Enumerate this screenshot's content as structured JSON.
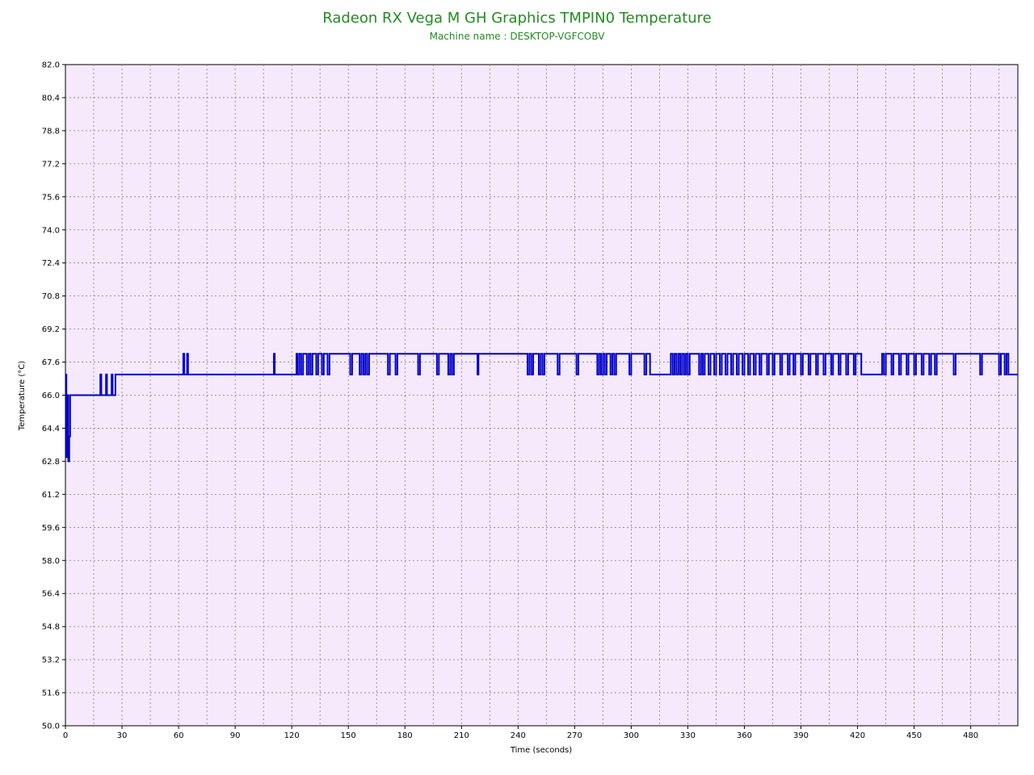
{
  "chart_data": {
    "type": "line",
    "title": "Radeon RX Vega M GH Graphics TMPIN0 Temperature",
    "subtitle": "Machine name : DESKTOP-VGFCOBV",
    "xlabel": "Time (seconds)",
    "ylabel": "Temperature (°C)",
    "xlim": [
      0,
      505
    ],
    "ylim": [
      50.0,
      82.0
    ],
    "x_ticks": [
      "0",
      "30",
      "60",
      "90",
      "120",
      "150",
      "180",
      "210",
      "240",
      "270",
      "300",
      "330",
      "360",
      "390",
      "420",
      "450",
      "480"
    ],
    "y_ticks": [
      "50.0",
      "51.6",
      "53.2",
      "54.8",
      "56.4",
      "58.0",
      "59.6",
      "61.2",
      "62.8",
      "64.4",
      "66.0",
      "67.6",
      "69.2",
      "70.8",
      "72.4",
      "74.0",
      "75.6",
      "77.2",
      "78.8",
      "80.4",
      "82.0"
    ],
    "grid": true,
    "colors": {
      "line": "#0000cc",
      "plot_bg": "#f5e9fb",
      "grid": "#808080",
      "title": "#228b22"
    },
    "series": [
      {
        "values": [
          [
            0,
            67
          ],
          [
            0.5,
            63
          ],
          [
            1,
            66
          ],
          [
            1.5,
            62.8
          ],
          [
            2,
            64
          ],
          [
            2.5,
            66
          ],
          [
            18,
            66
          ],
          [
            18.5,
            67
          ],
          [
            19,
            66
          ],
          [
            21,
            66
          ],
          [
            21.5,
            67
          ],
          [
            22,
            66
          ],
          [
            24,
            66
          ],
          [
            24.5,
            67
          ],
          [
            25,
            66
          ],
          [
            26,
            66
          ],
          [
            26.5,
            67
          ],
          [
            62,
            67
          ],
          [
            62.5,
            68
          ],
          [
            63,
            67
          ],
          [
            64,
            67
          ],
          [
            64.5,
            68
          ],
          [
            65,
            67
          ],
          [
            110,
            67
          ],
          [
            110.5,
            68
          ],
          [
            111,
            67
          ],
          [
            122,
            67
          ],
          [
            122.5,
            68
          ],
          [
            123,
            67
          ],
          [
            124,
            68
          ],
          [
            125,
            67
          ],
          [
            126,
            68
          ],
          [
            127,
            68
          ],
          [
            128,
            67
          ],
          [
            129,
            68
          ],
          [
            130,
            67
          ],
          [
            131,
            68
          ],
          [
            133,
            67
          ],
          [
            134,
            68
          ],
          [
            135,
            68
          ],
          [
            136,
            67
          ],
          [
            137,
            68
          ],
          [
            138,
            68
          ],
          [
            139,
            67
          ],
          [
            140,
            68
          ],
          [
            150,
            68
          ],
          [
            151,
            67
          ],
          [
            152,
            68
          ],
          [
            155,
            68
          ],
          [
            156,
            67
          ],
          [
            157,
            68
          ],
          [
            158,
            67
          ],
          [
            159,
            68
          ],
          [
            160,
            67
          ],
          [
            161,
            68
          ],
          [
            170,
            68
          ],
          [
            171,
            67
          ],
          [
            172,
            68
          ],
          [
            174,
            68
          ],
          [
            175,
            67
          ],
          [
            176,
            68
          ],
          [
            186,
            68
          ],
          [
            187,
            67
          ],
          [
            188,
            68
          ],
          [
            196,
            68
          ],
          [
            197,
            67
          ],
          [
            198,
            68
          ],
          [
            202,
            68
          ],
          [
            203,
            67
          ],
          [
            204,
            68
          ],
          [
            205,
            67
          ],
          [
            206,
            68
          ],
          [
            218,
            68
          ],
          [
            218.5,
            67
          ],
          [
            219,
            68
          ],
          [
            244,
            68
          ],
          [
            245,
            67
          ],
          [
            246,
            68
          ],
          [
            247,
            67
          ],
          [
            248,
            68
          ],
          [
            250,
            68
          ],
          [
            251,
            67
          ],
          [
            252,
            68
          ],
          [
            253,
            67
          ],
          [
            254,
            68
          ],
          [
            260,
            68
          ],
          [
            261,
            67
          ],
          [
            262,
            68
          ],
          [
            270,
            68
          ],
          [
            271,
            67
          ],
          [
            272,
            68
          ],
          [
            281,
            68
          ],
          [
            282,
            67
          ],
          [
            283,
            68
          ],
          [
            284,
            67
          ],
          [
            285,
            68
          ],
          [
            286,
            67
          ],
          [
            287,
            68
          ],
          [
            289,
            67
          ],
          [
            290,
            68
          ],
          [
            291,
            67
          ],
          [
            292,
            68
          ],
          [
            298,
            68
          ],
          [
            299,
            67
          ],
          [
            300,
            68
          ],
          [
            306,
            68
          ],
          [
            307,
            67
          ],
          [
            308,
            68
          ],
          [
            310,
            67
          ],
          [
            320,
            67
          ],
          [
            321,
            68
          ],
          [
            322,
            67
          ],
          [
            323,
            68
          ],
          [
            324,
            67
          ],
          [
            325,
            68
          ],
          [
            326,
            67
          ],
          [
            327,
            68
          ],
          [
            328,
            67
          ],
          [
            329,
            68
          ],
          [
            330,
            67
          ],
          [
            331,
            68
          ],
          [
            335,
            68
          ],
          [
            336,
            67
          ],
          [
            337,
            68
          ],
          [
            338,
            67
          ],
          [
            339,
            68
          ],
          [
            341,
            67
          ],
          [
            342,
            68
          ],
          [
            344,
            67
          ],
          [
            345,
            68
          ],
          [
            347,
            67
          ],
          [
            348,
            68
          ],
          [
            350,
            67
          ],
          [
            351,
            68
          ],
          [
            353,
            67
          ],
          [
            354,
            68
          ],
          [
            356,
            67
          ],
          [
            357,
            68
          ],
          [
            359,
            67
          ],
          [
            360,
            68
          ],
          [
            362,
            67
          ],
          [
            363,
            68
          ],
          [
            365,
            67
          ],
          [
            366,
            68
          ],
          [
            368,
            67
          ],
          [
            369,
            68
          ],
          [
            372,
            67
          ],
          [
            373,
            68
          ],
          [
            375,
            67
          ],
          [
            376,
            68
          ],
          [
            379,
            67
          ],
          [
            380,
            68
          ],
          [
            383,
            67
          ],
          [
            384,
            68
          ],
          [
            386,
            67
          ],
          [
            387,
            68
          ],
          [
            390,
            67
          ],
          [
            391,
            68
          ],
          [
            394,
            67
          ],
          [
            395,
            68
          ],
          [
            398,
            67
          ],
          [
            399,
            68
          ],
          [
            402,
            67
          ],
          [
            403,
            68
          ],
          [
            406,
            67
          ],
          [
            407,
            68
          ],
          [
            410,
            67
          ],
          [
            411,
            68
          ],
          [
            414,
            67
          ],
          [
            415,
            68
          ],
          [
            418,
            67
          ],
          [
            419,
            68
          ],
          [
            422,
            67
          ],
          [
            432,
            67
          ],
          [
            433,
            68
          ],
          [
            434,
            67
          ],
          [
            435,
            68
          ],
          [
            438,
            67
          ],
          [
            439,
            68
          ],
          [
            442,
            67
          ],
          [
            443,
            68
          ],
          [
            446,
            67
          ],
          [
            447,
            68
          ],
          [
            450,
            67
          ],
          [
            451,
            68
          ],
          [
            454,
            67
          ],
          [
            455,
            68
          ],
          [
            458,
            67
          ],
          [
            459,
            68
          ],
          [
            461,
            67
          ],
          [
            462,
            68
          ],
          [
            470,
            68
          ],
          [
            471,
            67
          ],
          [
            472,
            68
          ],
          [
            484,
            68
          ],
          [
            485,
            67
          ],
          [
            486,
            68
          ],
          [
            494,
            68
          ],
          [
            495,
            67
          ],
          [
            496,
            68
          ],
          [
            498,
            67
          ],
          [
            499,
            68
          ],
          [
            500,
            67
          ],
          [
            505,
            67
          ]
        ]
      }
    ]
  }
}
